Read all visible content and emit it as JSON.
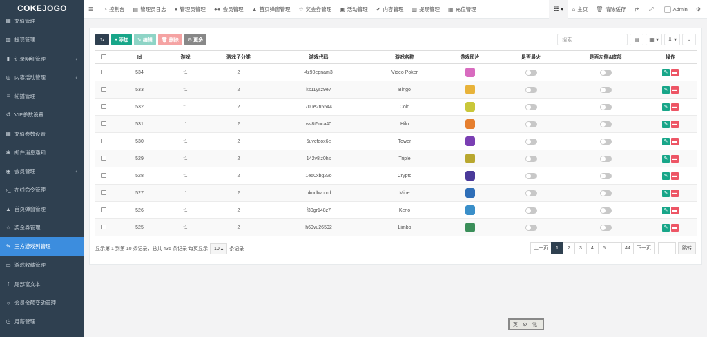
{
  "brand": "COKEJOGO",
  "sidebar": {
    "items": [
      {
        "label": "充值管理",
        "icon": "grid-icon",
        "chev": false
      },
      {
        "label": "提现管理",
        "icon": "bank-icon",
        "chev": false
      },
      {
        "label": "记录明细管理",
        "icon": "bar-chart-icon",
        "chev": true
      },
      {
        "label": "内容活动管理",
        "icon": "compass-icon",
        "chev": true
      },
      {
        "label": "轮播管理",
        "icon": "menu-icon",
        "chev": false
      },
      {
        "label": "VIP参数设置",
        "icon": "history-icon",
        "chev": false
      },
      {
        "label": "充值参数设置",
        "icon": "grid-icon",
        "chev": false
      },
      {
        "label": "邮件消息通知",
        "icon": "asterisk-icon",
        "chev": false
      },
      {
        "label": "会员管理",
        "icon": "user-circle-icon",
        "chev": true
      },
      {
        "label": "在线命令管理",
        "icon": "terminal-icon",
        "chev": false
      },
      {
        "label": "首页弹窗管理",
        "icon": "bell-icon",
        "chev": false
      },
      {
        "label": "奖金券管理",
        "icon": "star-icon",
        "chev": false
      },
      {
        "label": "三方游戏列管理",
        "icon": "wrench-icon",
        "chev": false,
        "active": true
      },
      {
        "label": "游戏收藏管理",
        "icon": "folder-icon",
        "chev": false
      },
      {
        "label": "尾部富文本",
        "icon": "facebook-icon",
        "chev": false
      },
      {
        "label": "会员余额变动管理",
        "icon": "circle-icon",
        "chev": false
      },
      {
        "label": "月薪管理",
        "icon": "money-icon",
        "chev": false
      }
    ]
  },
  "topbar": {
    "items": [
      {
        "label": "控制台",
        "icon": "dashboard-icon"
      },
      {
        "label": "管理员日志",
        "icon": "list-icon"
      },
      {
        "label": "管理员管理",
        "icon": "user-icon"
      },
      {
        "label": "会员管理",
        "icon": "users-icon"
      },
      {
        "label": "首页弹窗管理",
        "icon": "bell-icon"
      },
      {
        "label": "奖金券管理",
        "icon": "star-icon"
      },
      {
        "label": "活动管理",
        "icon": "calendar-icon"
      },
      {
        "label": "内容管理",
        "icon": "check-circle-icon"
      },
      {
        "label": "提现管理",
        "icon": "bank-icon"
      },
      {
        "label": "充值管理",
        "icon": "grid-icon"
      }
    ],
    "home": "主页",
    "clear_cache": "清除缓存",
    "admin": "Admin"
  },
  "toolbar": {
    "add": "+ 添加",
    "edit": "编辑",
    "delete": "删除",
    "more": "更多",
    "search_placeholder": "搜索"
  },
  "table": {
    "headers": [
      "Id",
      "游戏",
      "游戏子分类",
      "游戏代码",
      "游戏名称",
      "游戏图片",
      "是否最火",
      "是否左侧&底部",
      "操作"
    ],
    "rows": [
      {
        "id": "534",
        "game": "t1",
        "sub": "2",
        "code": "4z90epnam3",
        "name": "Video Poker",
        "img_color": "#d86bbf"
      },
      {
        "id": "533",
        "game": "t1",
        "sub": "2",
        "code": "ks11ysz9e7",
        "name": "Bingo",
        "img_color": "#e8b33a"
      },
      {
        "id": "532",
        "game": "t1",
        "sub": "2",
        "code": "70ue2n5544",
        "name": "Coin",
        "img_color": "#c9c73a"
      },
      {
        "id": "531",
        "game": "t1",
        "sub": "2",
        "code": "wv8t5nca40",
        "name": "Hilo",
        "img_color": "#e67f2f"
      },
      {
        "id": "530",
        "game": "t1",
        "sub": "2",
        "code": "5uvcfeox6e",
        "name": "Tower",
        "img_color": "#7a3fb3"
      },
      {
        "id": "529",
        "game": "t1",
        "sub": "2",
        "code": "142v8jz0hs",
        "name": "Triple",
        "img_color": "#b9a830"
      },
      {
        "id": "528",
        "game": "t1",
        "sub": "2",
        "code": "1e50xbg2vo",
        "name": "Crypto",
        "img_color": "#4a3a9a"
      },
      {
        "id": "527",
        "game": "t1",
        "sub": "2",
        "code": "ukudfwcord",
        "name": "Mine",
        "img_color": "#2f6fb8"
      },
      {
        "id": "526",
        "game": "t1",
        "sub": "2",
        "code": "f30gr148z7",
        "name": "Keno",
        "img_color": "#3a8fc9"
      },
      {
        "id": "525",
        "game": "t1",
        "sub": "2",
        "code": "h69vu26592",
        "name": "Limbo",
        "img_color": "#3b8f5a"
      }
    ]
  },
  "pagination": {
    "info_prefix": "显示第 1 到第 10 条记录，总共 435 条记录 每页显示",
    "page_size": "10",
    "info_suffix": "条记录",
    "prev": "上一页",
    "pages": [
      "1",
      "2",
      "3",
      "4",
      "5",
      "...",
      "44"
    ],
    "next": "下一页",
    "jump": "跳转"
  },
  "footer_stamp": "英 ⅁ 牝"
}
